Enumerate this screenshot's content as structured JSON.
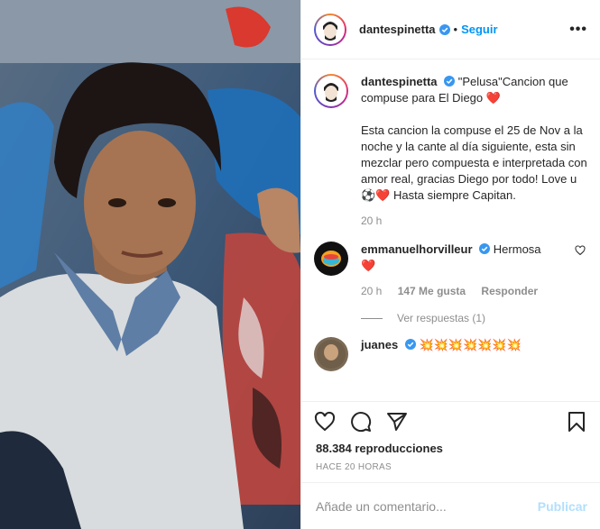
{
  "post": {
    "username": "dantespinetta",
    "follow_label": "Seguir",
    "caption": {
      "line1": "\"Pelusa\"Cancion que compuse para El Diego",
      "line2": "Esta cancion la compuse el 25 de Nov a la noche y la cante al día siguiente, esta sin mezclar pero compuesta e interpretada con amor real, gracias Diego por todo! Love u",
      "line3": "Hasta siempre Capitan.",
      "time": "20 h"
    },
    "comments": [
      {
        "username": "emmanuelhorvilleur",
        "text": "Hermosa",
        "time": "20 h",
        "likes": "147 Me gusta",
        "reply_label": "Responder",
        "view_replies": "Ver respuestas (1)"
      },
      {
        "username": "juanes",
        "text": "💥💥💥💥💥💥💥"
      }
    ],
    "views": "88.384 reproducciones",
    "timestamp": "HACE 20 HORAS",
    "add_comment_placeholder": "Añade un comentario...",
    "publish_label": "Publicar"
  }
}
